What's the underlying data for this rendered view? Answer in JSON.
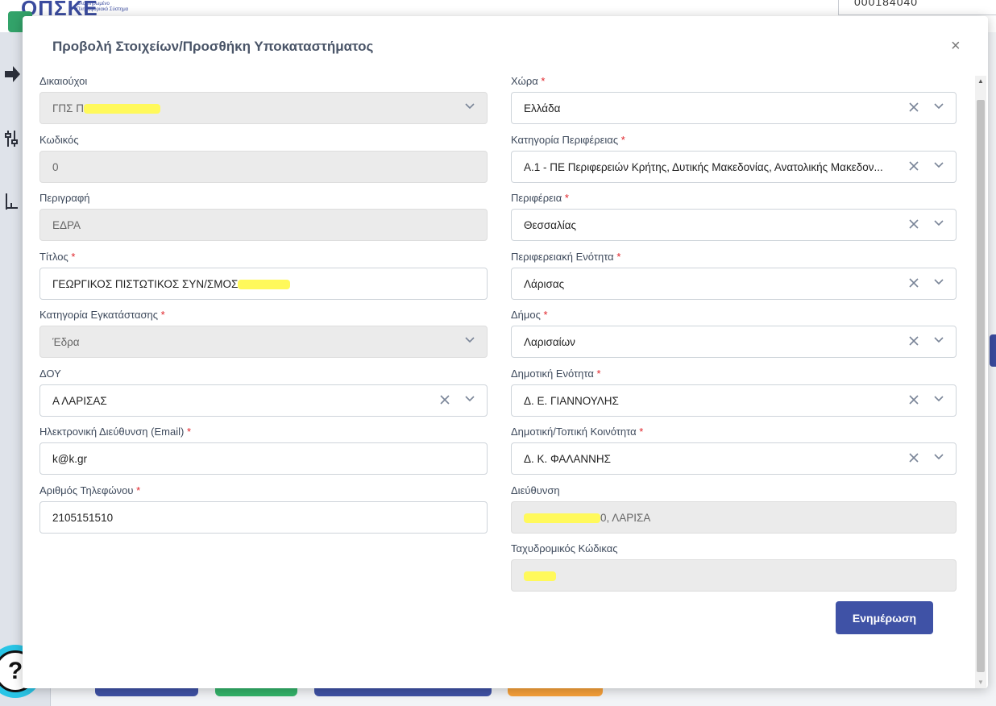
{
  "app": {
    "logo": "ΟΠΣΚΕ",
    "logo_subtitle_1": "Ολοκληρωμένο",
    "logo_subtitle_2": "Πληροφοριακό Σύστημα",
    "top_value": "000184040"
  },
  "modal": {
    "title": "Προβολή Στοιχείων/Προσθήκη Υποκαταστήματος",
    "close_label": "×",
    "left_fields": [
      {
        "label": "Δικαιούχοι",
        "required": "",
        "value": "ΓΠΣ Π",
        "type": "select-disabled"
      },
      {
        "label": "Κωδικός",
        "required": "",
        "value": "0",
        "type": "disabled"
      },
      {
        "label": "Περιγραφή",
        "required": "",
        "value": "ΕΔΡΑ",
        "type": "disabled"
      },
      {
        "label": "Τίτλος",
        "required": "*",
        "value": "ΓΕΩΡΓΙΚΟΣ ΠΙΣΤΩΤΙΚΟΣ ΣΥΝ/ΣΜΟΣ",
        "type": "input"
      },
      {
        "label": "Κατηγορία Εγκατάστασης",
        "required": "*",
        "value": "Έδρα",
        "type": "select-disabled"
      },
      {
        "label": "ΔΟΥ",
        "required": "",
        "value": "Α ΛΑΡΙΣΑΣ",
        "type": "select"
      },
      {
        "label": "Ηλεκτρονική Διεύθυνση (Email)",
        "required": "*",
        "value": "k@k.gr",
        "type": "input"
      },
      {
        "label": "Αριθμός Τηλεφώνου",
        "required": "*",
        "value": "2105151510",
        "type": "input"
      }
    ],
    "right_fields": [
      {
        "label": "Χώρα",
        "required": "*",
        "value": "Ελλάδα",
        "type": "select"
      },
      {
        "label": "Κατηγορία Περιφέρειας",
        "required": "*",
        "value": "Α.1 - ΠΕ Περιφερειών Κρήτης, Δυτικής Μακεδονίας, Ανατολικής Μακεδον...",
        "type": "select"
      },
      {
        "label": "Περιφέρεια",
        "required": "*",
        "value": "Θεσσαλίας",
        "type": "select"
      },
      {
        "label": "Περιφερειακή Ενότητα",
        "required": "*",
        "value": "Λάρισας",
        "type": "select"
      },
      {
        "label": "Δήμος",
        "required": "*",
        "value": "Λαρισαίων",
        "type": "select"
      },
      {
        "label": "Δημοτική Ενότητα",
        "required": "*",
        "value": "Δ. Ε. ΓΙΑΝΝΟΥΛΗΣ",
        "type": "select"
      },
      {
        "label": "Δημοτική/Τοπική Κοινότητα",
        "required": "*",
        "value": "Δ. Κ. ΦΑΛΑΝΝΗΣ",
        "type": "select"
      },
      {
        "label": "Διεύθυνση",
        "required": "",
        "value": "0, ΛΑΡΙΣΑ",
        "type": "disabled"
      },
      {
        "label": "Ταχυδρομικός Κώδικας",
        "required": "",
        "value": "",
        "type": "disabled"
      }
    ],
    "update_button": "Ενημέρωση"
  },
  "colors": {
    "primary": "#3f52a6",
    "required": "#e0242a",
    "redaction": "#fff95b"
  }
}
